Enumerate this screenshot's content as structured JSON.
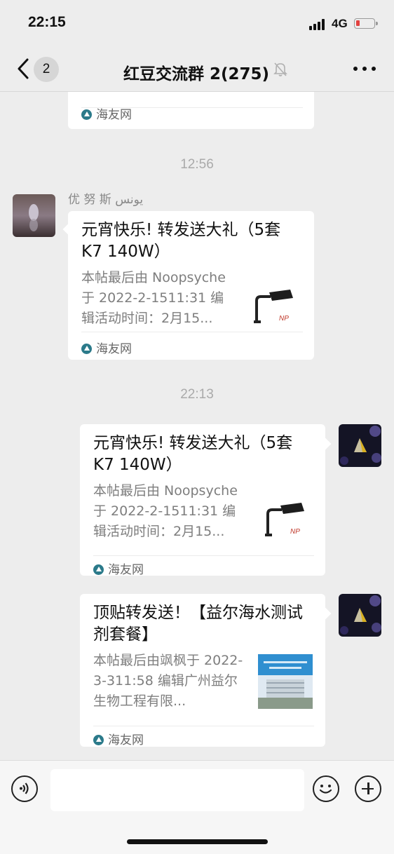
{
  "status_bar": {
    "time": "22:15",
    "network": "4G",
    "battery_level": 0.12
  },
  "nav": {
    "back_count": "2",
    "title": "红豆交流群 2(275)"
  },
  "messages": [
    {
      "source": "海友网"
    },
    {
      "timestamp": "12:56",
      "sender": "优 努 斯  يونس",
      "title": "元宵快乐! 转发送大礼（5套 K7  140W）",
      "desc": "本帖最后由 Noopsyche 于 2022-2-1511:31 编辑活动时间：2月15...",
      "source": "海友网",
      "thumb_icon": "lamp-product-icon"
    },
    {
      "timestamp": "22:13",
      "title": "元宵快乐! 转发送大礼（5套 K7  140W）",
      "desc": "本帖最后由 Noopsyche 于 2022-2-1511:31 编辑活动时间：2月15...",
      "source": "海友网",
      "thumb_icon": "lamp-product-icon"
    },
    {
      "title": "顶贴转发送！【益尔海水测试剂套餐】",
      "desc": "本帖最后由飒枫于 2022-3-311:58 编辑广州益尔生物工程有限...",
      "source": "海友网",
      "thumb_icon": "building-photo-icon"
    }
  ],
  "input_bar": {
    "placeholder": ""
  },
  "colors": {
    "background": "#ededed",
    "card": "#ffffff",
    "meta_text": "#7e7e7e",
    "battery_low": "#e2413f"
  }
}
